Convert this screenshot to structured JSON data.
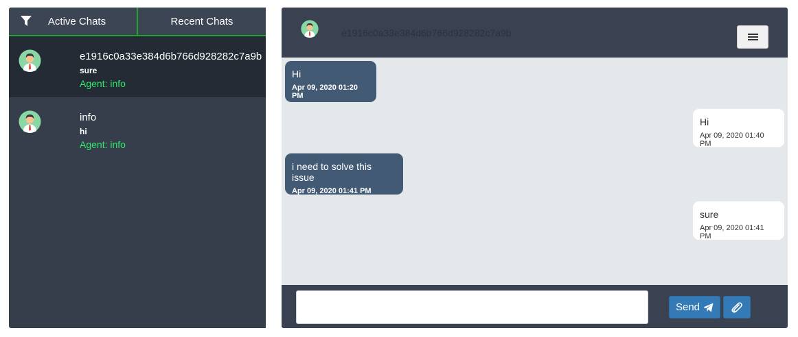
{
  "tabs": {
    "active_label": "Active Chats",
    "recent_label": "Recent Chats"
  },
  "chat_list": [
    {
      "name": "e1916c0a33e384d6b766d928282c7a9b",
      "last_message": "sure",
      "agent": "Agent: info",
      "selected": true
    },
    {
      "name": "info",
      "last_message": "hi",
      "agent": "Agent: info",
      "selected": false
    }
  ],
  "conversation": {
    "header_name": "e1916c0a33e384d6b766d928282c7a9b",
    "messages": [
      {
        "direction": "in",
        "text": "Hi",
        "time": "Apr 09, 2020 01:20 PM"
      },
      {
        "direction": "out",
        "text": "Hi",
        "time": "Apr 09, 2020 01:40 PM"
      },
      {
        "direction": "in",
        "text": "i need to solve this issue",
        "time": "Apr 09, 2020 01:41 PM"
      },
      {
        "direction": "out",
        "text": "sure",
        "time": "Apr 09, 2020 01:41 PM"
      }
    ]
  },
  "composer": {
    "input_value": "",
    "send_label": "Send"
  },
  "icons": {
    "filter": "filter-icon",
    "avatar": "user-avatar-icon",
    "menu": "hamburger-menu-icon",
    "send": "paper-plane-icon",
    "attach": "paperclip-icon"
  },
  "colors": {
    "accent_green": "#22a32a",
    "agent_green": "#2ee86a",
    "incoming_bubble": "#435a75",
    "primary_button": "#337ab7"
  }
}
